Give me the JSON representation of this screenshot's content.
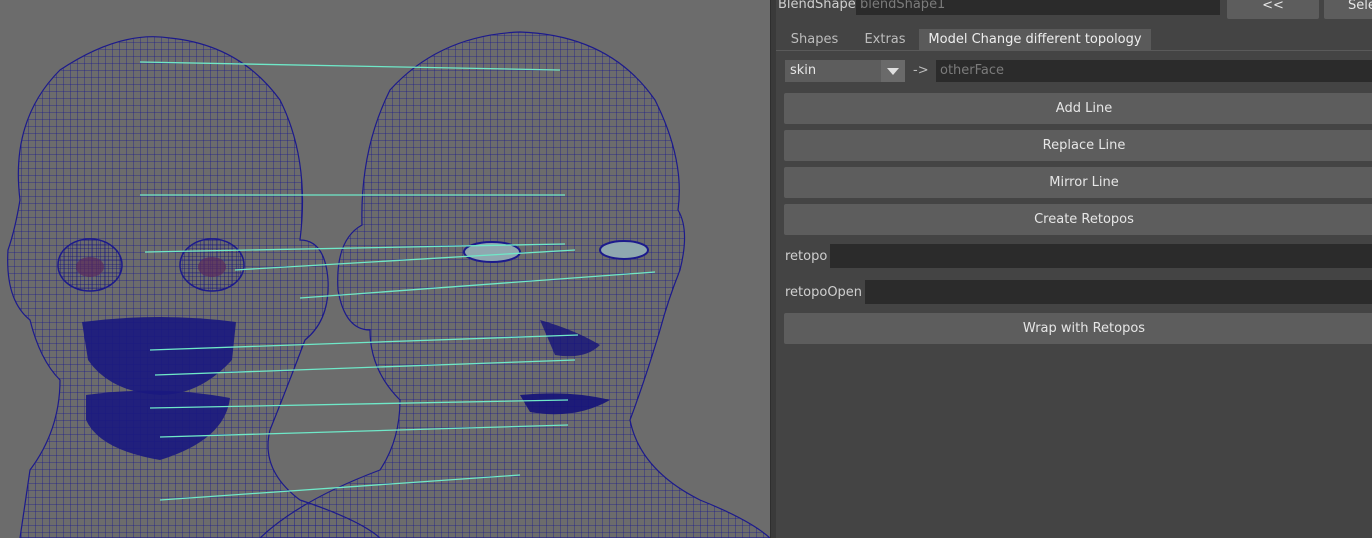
{
  "blendshape": {
    "label": "BlendShape",
    "value": "blendShape1",
    "prev_button": "<<",
    "select_button": "Sele"
  },
  "tabs": [
    {
      "label": "Shapes"
    },
    {
      "label": "Extras"
    },
    {
      "label": "Model Change different topology",
      "active": true
    }
  ],
  "mapping": {
    "source_value": "skin",
    "arrow": "->",
    "target_placeholder": "otherFace"
  },
  "buttons": {
    "add_line": "Add Line",
    "replace_line": "Replace Line",
    "mirror_line": "Mirror Line",
    "create_retopos": "Create Retopos",
    "wrap_with_retopos": "Wrap with Retopos"
  },
  "fields": {
    "retopo_label": "retopo",
    "retopo_value": "",
    "retopo_open_label": "retopoOpen",
    "retopo_open_value": ""
  },
  "colors": {
    "wireframe": "#1c1a8c",
    "guide_lines": "#6fe8c8",
    "viewport_bg": "#6c6c6c",
    "panel_bg": "#444444"
  }
}
